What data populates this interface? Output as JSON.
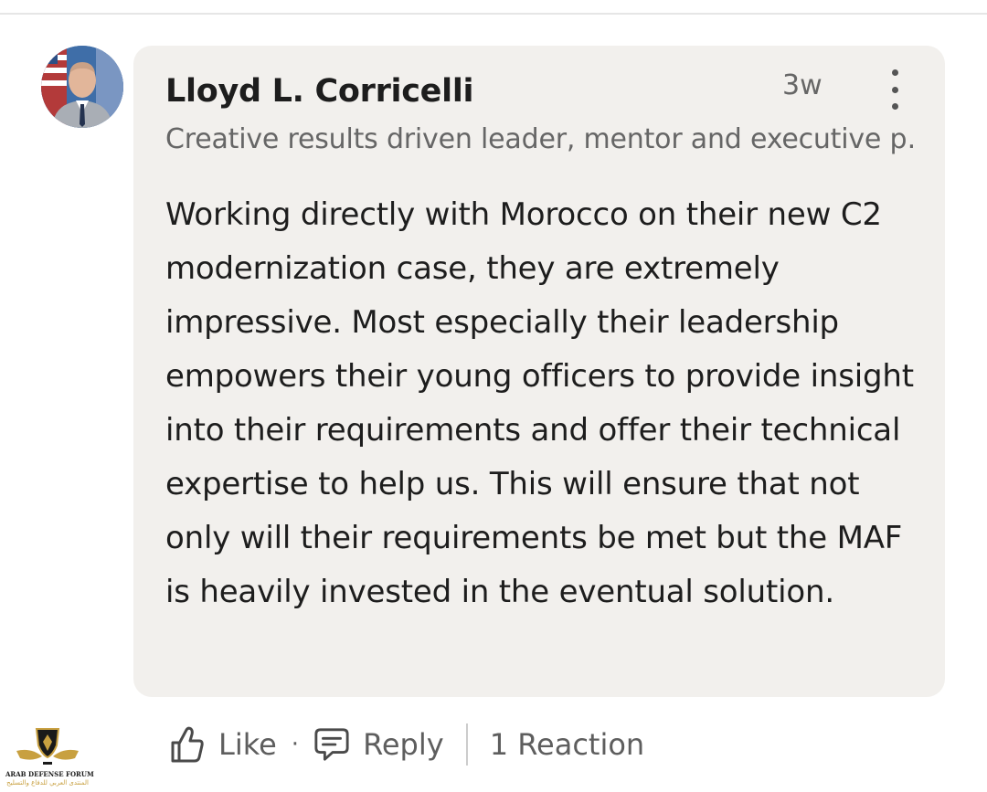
{
  "comment": {
    "author_name": "Lloyd L. Corricelli",
    "timestamp": "3w",
    "headline": "Creative results driven leader, mentor and executive p…",
    "body": "Working directly with Morocco on their new C2 modernization case, they are extremely impressive. Most especially their leadership empowers their young officers to provide insight into their requirements and offer their technical expertise to help us. This will ensure that not only will their requirements be met but the MAF is heavily invested in the eventual solution."
  },
  "actions": {
    "like_label": "Like",
    "separator": "·",
    "reply_label": "Reply",
    "reactions_label": "1 Reaction"
  },
  "icons": {
    "avatar": "profile-photo",
    "more": "more-vertical-icon",
    "like": "thumbs-up-icon",
    "reply": "speech-bubble-icon",
    "watermark": "arab-defense-forum-logo"
  },
  "watermark": {
    "line1": "ARAB DEFENSE FORUM",
    "line2": "المنتدى العربي للدفاع والتسليح"
  },
  "colors": {
    "card_background": "#f2f0ed",
    "primary_text": "#1d1d1d",
    "secondary_text": "#666666"
  }
}
